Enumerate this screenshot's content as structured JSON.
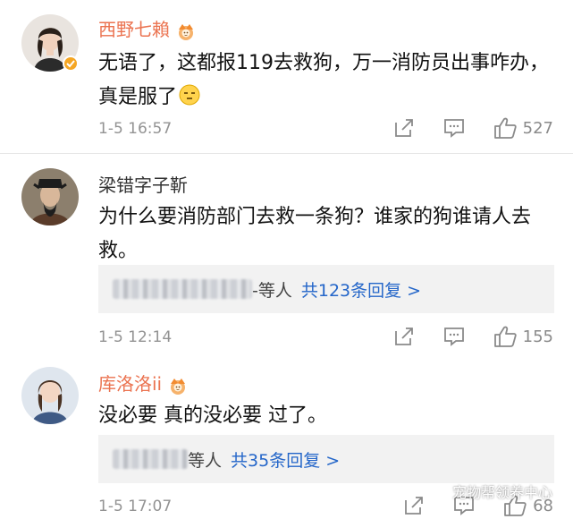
{
  "comments": [
    {
      "username": "西野七賴",
      "text": "无语了，这都报119去救狗，万一消防员出事咋办，真是服了",
      "timestamp": "1-5 16:57",
      "like_count": "527",
      "name_color": "#eb7350"
    },
    {
      "username": "梁错字子靳",
      "text": "为什么要消防部门去救一条狗？谁家的狗谁请人去救。",
      "reply_summary": "-等人",
      "reply_link": "共123条回复 >",
      "timestamp": "1-5 12:14",
      "like_count": "155"
    },
    {
      "username": "库洛洛ii",
      "text": "没必要 真的没必要 过了。",
      "reply_summary": "等人",
      "reply_link": "共35条回复 >",
      "timestamp": "1-5 17:07",
      "like_count": "68"
    }
  ],
  "watermark": {
    "text": "宠物帮领养中心"
  },
  "colors": {
    "accent_name": "#eb7350",
    "link": "#2466c9",
    "meta": "#939393",
    "reply_bg": "#f2f2f2"
  },
  "icons": [
    "share-icon",
    "comment-icon",
    "like-icon",
    "vip-crown-icon",
    "verified-icon",
    "wechat-icon"
  ]
}
